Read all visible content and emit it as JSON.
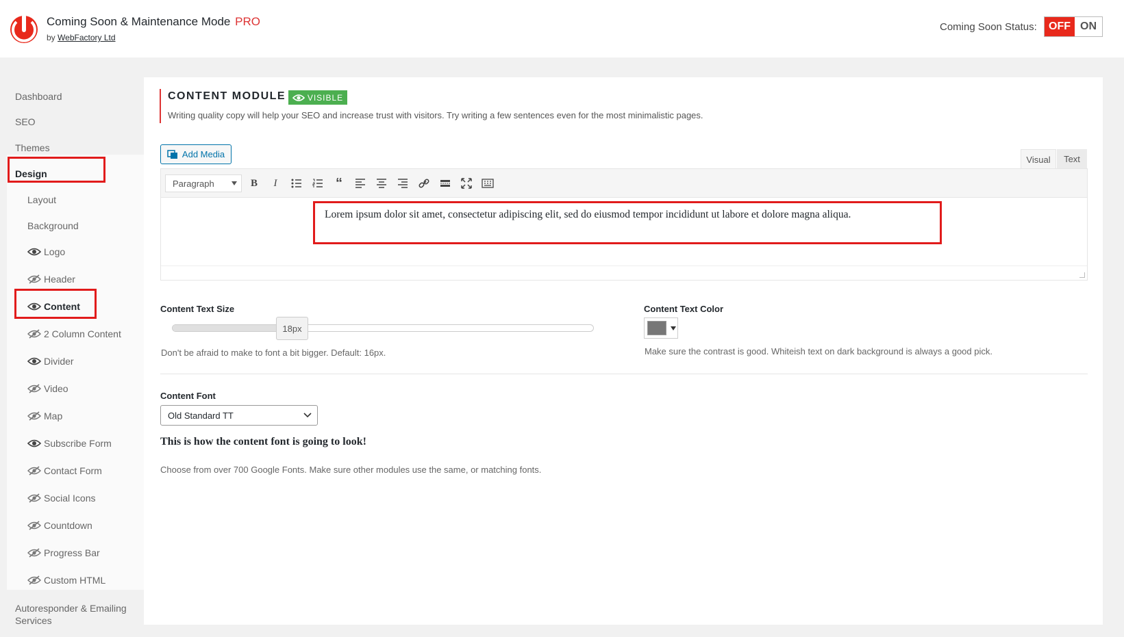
{
  "header": {
    "app_name": "Coming Soon & Maintenance Mode",
    "pro_label": "PRO",
    "by_prefix": "by",
    "vendor": "WebFactory Ltd",
    "status_label": "Coming Soon Status:",
    "toggle_off": "OFF",
    "toggle_on": "ON",
    "toggle_state": "OFF"
  },
  "sidebar": {
    "items": [
      {
        "label": "Dashboard"
      },
      {
        "label": "SEO"
      },
      {
        "label": "Themes"
      },
      {
        "label": "Design",
        "active": true
      },
      {
        "label": "Layout"
      },
      {
        "label": "Background"
      },
      {
        "label": "Logo",
        "icon": "eye-icon"
      },
      {
        "label": "Header",
        "icon": "eye-slash-icon"
      },
      {
        "label": "Content",
        "icon": "eye-icon",
        "active": true
      },
      {
        "label": "2 Column Content",
        "icon": "eye-slash-icon"
      },
      {
        "label": "Divider",
        "icon": "eye-icon"
      },
      {
        "label": "Video",
        "icon": "eye-slash-icon"
      },
      {
        "label": "Map",
        "icon": "eye-slash-icon"
      },
      {
        "label": "Subscribe Form",
        "icon": "eye-icon"
      },
      {
        "label": "Contact Form",
        "icon": "eye-slash-icon"
      },
      {
        "label": "Social Icons",
        "icon": "eye-slash-icon"
      },
      {
        "label": "Countdown",
        "icon": "eye-slash-icon"
      },
      {
        "label": "Progress Bar",
        "icon": "eye-slash-icon"
      },
      {
        "label": "Custom HTML",
        "icon": "eye-slash-icon"
      },
      {
        "label": "Autoresponder & Emailing",
        "label2": "Services"
      }
    ]
  },
  "module": {
    "title": "CONTENT MODULE",
    "badge": "VISIBLE",
    "description": "Writing quality copy will help your SEO and increase trust with visitors. Try writing a few sentences even for the most minimalistic pages."
  },
  "editor": {
    "add_media": "Add Media",
    "tab_visual": "Visual",
    "tab_text": "Text",
    "format": "Paragraph",
    "content": "Lorem ipsum dolor sit amet, consectetur adipiscing elit, sed do eiusmod tempor incididunt ut labore et dolore magna aliqua."
  },
  "text_size": {
    "label": "Content Text Size",
    "value": "18px",
    "fraction": 0.28,
    "help": "Don't be afraid to make to font a bit bigger. Default: 16px."
  },
  "text_color": {
    "label": "Content Text Color",
    "color": "#777777",
    "help": "Make sure the contrast is good. Whiteish text on dark background is always a good pick."
  },
  "font": {
    "label": "Content Font",
    "value": "Old Standard TT",
    "preview": "This is how the content font is going to look!",
    "help": "Choose from over 700 Google Fonts. Make sure other modules use the same, or matching fonts."
  },
  "colors": {
    "accent_red": "#e11b1b",
    "visible_green": "#4caf50",
    "link_blue": "#0073aa"
  }
}
